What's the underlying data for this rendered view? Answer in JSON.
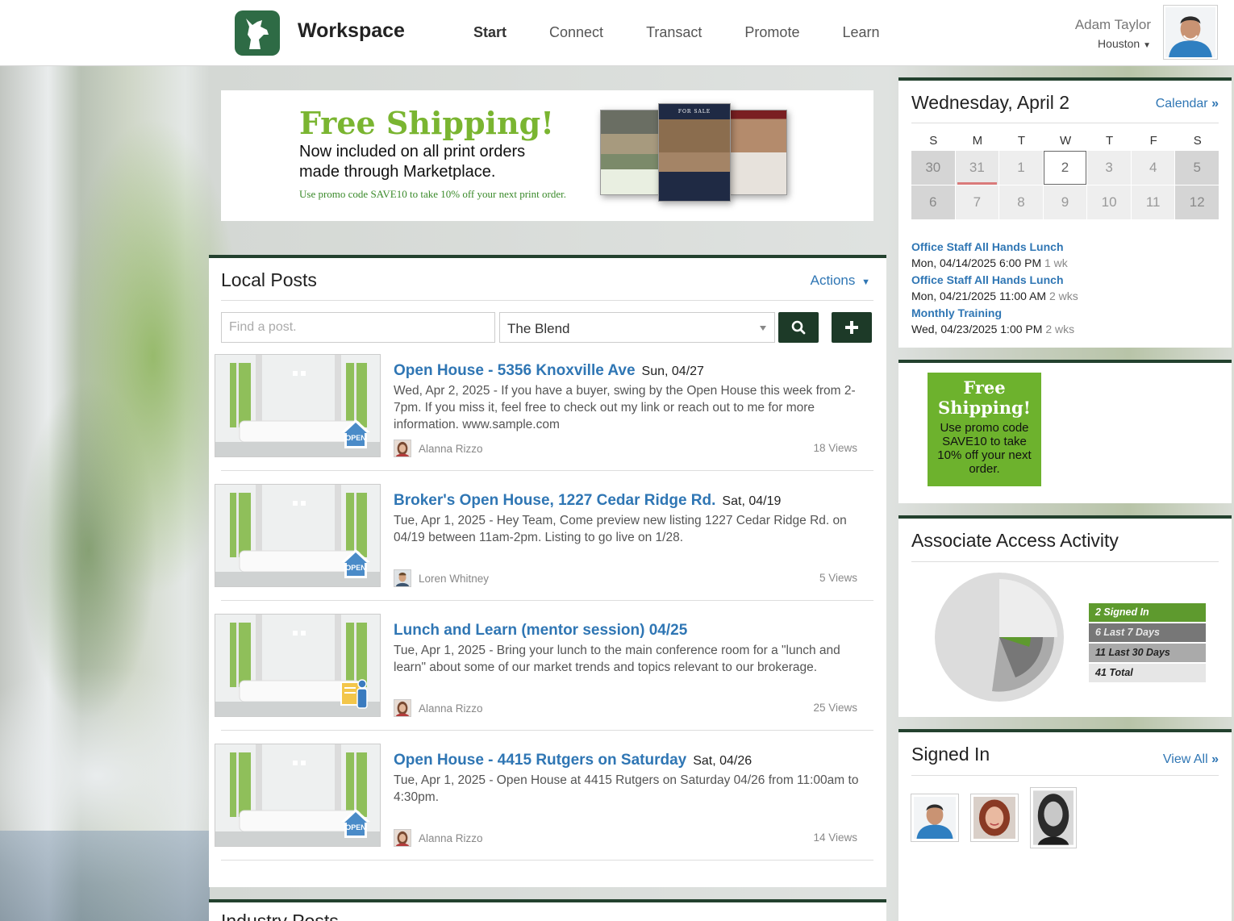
{
  "header": {
    "brand": "Workspace",
    "nav": [
      {
        "label": "Start",
        "active": true
      },
      {
        "label": "Connect"
      },
      {
        "label": "Transact"
      },
      {
        "label": "Promote"
      },
      {
        "label": "Learn"
      }
    ],
    "user_name": "Adam Taylor",
    "user_location": "Houston"
  },
  "banner": {
    "title": "Free Shipping!",
    "subtitle": "Now included on all print orders made through Marketplace.",
    "note": "Use promo code SAVE10 to take 10% off your next print order.",
    "flyer_label": "FOR SALE"
  },
  "posts": {
    "title": "Local Posts",
    "actions_label": "Actions",
    "search_placeholder": "Find a post.",
    "filter_value": "The Blend",
    "items": [
      {
        "title": "Open House - 5356 Knoxville Ave",
        "date": "Sun, 04/27",
        "body": "Wed, Apr 2, 2025 - If you have a buyer, swing by the Open House this week from 2-7pm. If you miss it, feel free to check out my link or reach out to me for more information. www.sample.com",
        "author": "Alanna Rizzo",
        "views": "18 Views",
        "badge": "OPEN"
      },
      {
        "title": "Broker's Open House, 1227 Cedar Ridge Rd.",
        "date": "Sat, 04/19",
        "body": "Tue, Apr 1, 2025 - Hey Team, Come preview new listing 1227 Cedar Ridge Rd. on 04/19 between 11am-2pm. Listing to go live on 1/28.",
        "author": "Loren Whitney",
        "views": "5 Views",
        "badge": "OPEN"
      },
      {
        "title": "Lunch and Learn (mentor session) 04/25",
        "date": "",
        "body": "Tue, Apr 1, 2025 - Bring your lunch to the main conference room for a \"lunch and learn\" about some of our market trends and topics relevant to our brokerage.",
        "author": "Alanna Rizzo",
        "views": "25 Views",
        "badge": ""
      },
      {
        "title": "Open House - 4415 Rutgers on Saturday",
        "date": "Sat, 04/26",
        "body": "Tue, Apr 1, 2025 - Open House at 4415 Rutgers on Saturday 04/26 from 11:00am to 4:30pm.",
        "author": "Alanna Rizzo",
        "views": "14 Views",
        "badge": "OPEN"
      }
    ]
  },
  "industry": {
    "title": "Industry Posts"
  },
  "calendar": {
    "title": "Wednesday, April 2",
    "link": "Calendar",
    "dow": [
      "S",
      "M",
      "T",
      "W",
      "T",
      "F",
      "S"
    ],
    "weeks": [
      [
        "30",
        "31",
        "1",
        "2",
        "3",
        "4",
        "5"
      ],
      [
        "6",
        "7",
        "8",
        "9",
        "10",
        "11",
        "12"
      ]
    ],
    "events": [
      {
        "title": "Office Staff All Hands Lunch",
        "time": "Mon, 04/14/2025 6:00 PM",
        "rel": "1 wk"
      },
      {
        "title": "Office Staff All Hands Lunch",
        "time": "Mon, 04/21/2025 11:00 AM",
        "rel": "2 wks"
      },
      {
        "title": "Monthly Training",
        "time": "Wed, 04/23/2025 1:00 PM",
        "rel": "2 wks"
      }
    ]
  },
  "ad": {
    "title": "Free Shipping!",
    "text": "Use promo code SAVE10 to take 10% off your next order."
  },
  "activity": {
    "title": "Associate Access Activity",
    "legend": [
      "2 Signed In",
      "6 Last 7 Days",
      "11 Last 30 Days",
      "41 Total"
    ],
    "colors": {
      "signed_in": "#5e9a2e",
      "last7": "#777777",
      "last30": "#aaaaaa",
      "total": "#e6e6e6"
    }
  },
  "signed_in": {
    "title": "Signed In",
    "link": "View All"
  },
  "colors": {
    "accent": "#23412e",
    "link": "#2f76b4",
    "promo_green": "#7ab531"
  }
}
